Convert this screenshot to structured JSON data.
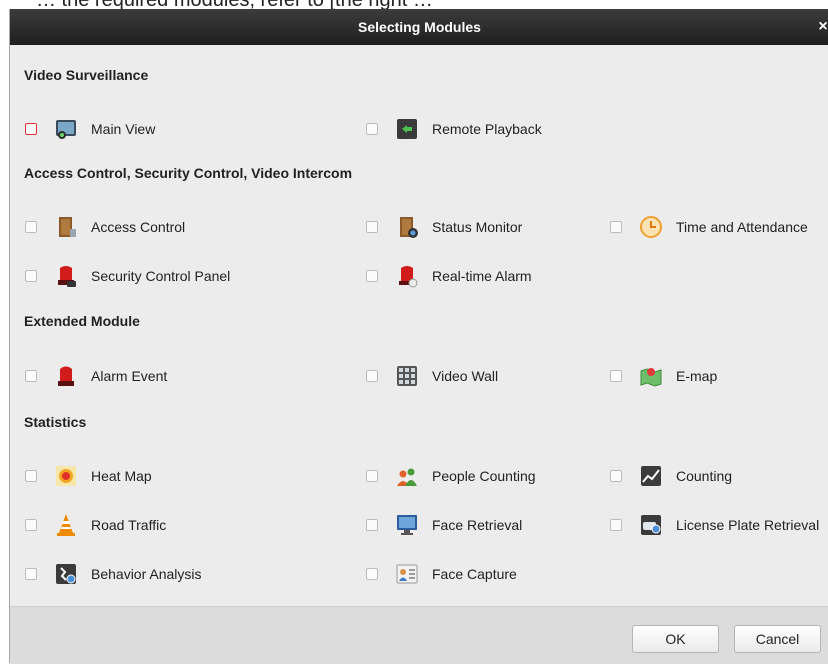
{
  "partial_header_text": "… the required modules, refer to [the right …",
  "dialog": {
    "title": "Selecting Modules",
    "close_glyph": "×"
  },
  "sections": {
    "video_surveillance": {
      "title": "Video Surveillance",
      "items": {
        "main_view": {
          "label": "Main View",
          "checked": false,
          "icon": "main-view-icon"
        },
        "remote_playback": {
          "label": "Remote Playback",
          "checked": false,
          "icon": "remote-playback-icon"
        }
      }
    },
    "access_control": {
      "title": "Access Control, Security Control, Video Intercom",
      "items": {
        "access_control": {
          "label": "Access Control",
          "checked": false,
          "icon": "door-icon"
        },
        "status_monitor": {
          "label": "Status Monitor",
          "checked": false,
          "icon": "status-monitor-icon"
        },
        "time_attendance": {
          "label": "Time and Attendance",
          "checked": false,
          "icon": "clock-icon"
        },
        "security_control_panel": {
          "label": "Security Control Panel",
          "checked": false,
          "icon": "siren-panel-icon"
        },
        "realtime_alarm": {
          "label": "Real-time Alarm",
          "checked": false,
          "icon": "siren-icon"
        }
      }
    },
    "extended": {
      "title": "Extended Module",
      "items": {
        "alarm_event": {
          "label": "Alarm Event",
          "checked": false,
          "icon": "alarm-light-icon"
        },
        "video_wall": {
          "label": "Video Wall",
          "checked": false,
          "icon": "video-wall-icon"
        },
        "emap": {
          "label": "E-map",
          "checked": false,
          "icon": "map-icon"
        }
      }
    },
    "statistics": {
      "title": "Statistics",
      "items": {
        "heat_map": {
          "label": "Heat Map",
          "checked": false,
          "icon": "heat-map-icon"
        },
        "people_counting": {
          "label": "People Counting",
          "checked": false,
          "icon": "people-icon"
        },
        "counting": {
          "label": "Counting",
          "checked": false,
          "icon": "counting-icon"
        },
        "road_traffic": {
          "label": "Road Traffic",
          "checked": false,
          "icon": "traffic-cone-icon"
        },
        "face_retrieval": {
          "label": "Face Retrieval",
          "checked": false,
          "icon": "face-retrieval-icon"
        },
        "license_plate_retrieval": {
          "label": "License Plate Retrieval",
          "checked": false,
          "icon": "license-plate-icon"
        },
        "behavior_analysis": {
          "label": "Behavior Analysis",
          "checked": false,
          "icon": "behavior-analysis-icon"
        },
        "face_capture": {
          "label": "Face Capture",
          "checked": false,
          "icon": "face-capture-icon"
        }
      }
    }
  },
  "buttons": {
    "ok": "OK",
    "cancel": "Cancel"
  },
  "colors": {
    "titlebar": "#2b2b2b",
    "dialog_bg": "#ececec",
    "footer_bg": "#dcdcdc",
    "focus": "#dd3333"
  }
}
